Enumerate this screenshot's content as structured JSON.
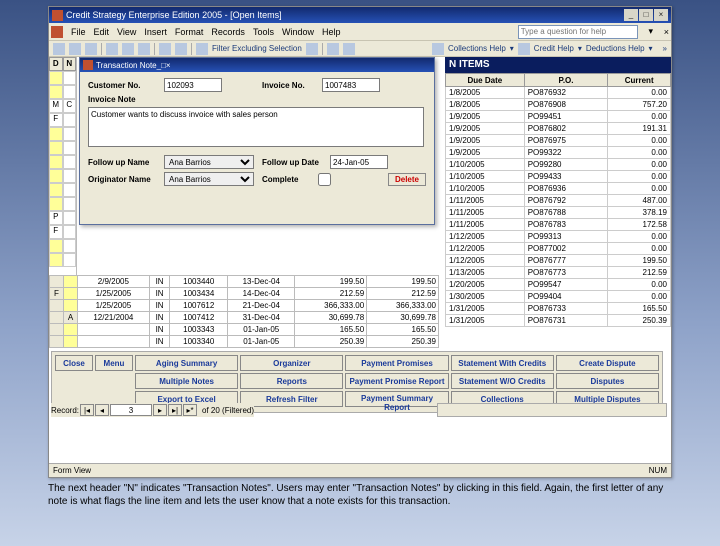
{
  "title_bar": {
    "title": "Credit Strategy Enterprise Edition 2005 - [Open Items]"
  },
  "menu": {
    "file": "File",
    "edit": "Edit",
    "view": "View",
    "insert": "Insert",
    "format": "Format",
    "records": "Records",
    "tools": "Tools",
    "window": "Window",
    "help": "Help",
    "help_placeholder": "Type a question for help"
  },
  "toolbar2": {
    "filter": "Filter Excluding Selection",
    "coll_help": "Collections Help",
    "cred_help": "Credit Help",
    "ded_help": "Deductions Help"
  },
  "left_hdr": {
    "d": "D",
    "n": "N",
    "m": "M",
    "f": "F",
    "p": "P",
    "a": "A",
    "c": "C"
  },
  "inner": {
    "title": "Transaction Note",
    "cust_no_lbl": "Customer No.",
    "cust_no": "102093",
    "inv_no_lbl": "Invoice No.",
    "inv_no": "1007483",
    "note_lbl": "Invoice Note",
    "note_text": "Customer wants to discuss invoice with sales person",
    "fup_name_lbl": "Follow up Name",
    "fup_name": "Ana Barrios",
    "fup_date_lbl": "Follow up Date",
    "fup_date": "24-Jan-05",
    "orig_name_lbl": "Originator Name",
    "orig_name": "Ana Barrios",
    "complete_lbl": "Complete",
    "delete": "Delete"
  },
  "right": {
    "banner": "N ITEMS",
    "hdr": {
      "due": "Due Date",
      "po": "P.O.",
      "curr": "Current"
    },
    "rows": [
      {
        "due": "1/8/2005",
        "po": "PO876932",
        "curr": "0.00"
      },
      {
        "due": "1/8/2005",
        "po": "PO876908",
        "curr": "757.20"
      },
      {
        "due": "1/9/2005",
        "po": "PO99451",
        "curr": "0.00"
      },
      {
        "due": "1/9/2005",
        "po": "PO876802",
        "curr": "191.31"
      },
      {
        "due": "1/9/2005",
        "po": "PO876975",
        "curr": "0.00"
      },
      {
        "due": "1/9/2005",
        "po": "PO99322",
        "curr": "0.00"
      },
      {
        "due": "1/10/2005",
        "po": "PO99280",
        "curr": "0.00"
      },
      {
        "due": "1/10/2005",
        "po": "PO99433",
        "curr": "0.00"
      },
      {
        "due": "1/10/2005",
        "po": "PO876936",
        "curr": "0.00"
      },
      {
        "due": "1/11/2005",
        "po": "PO876792",
        "curr": "487.00"
      },
      {
        "due": "1/11/2005",
        "po": "PO876788",
        "curr": "378.19"
      },
      {
        "due": "1/11/2005",
        "po": "PO876783",
        "curr": "172.58"
      },
      {
        "due": "1/12/2005",
        "po": "PO99313",
        "curr": "0.00"
      },
      {
        "due": "1/12/2005",
        "po": "PO877002",
        "curr": "0.00"
      },
      {
        "due": "1/12/2005",
        "po": "PO876777",
        "curr": "199.50"
      },
      {
        "due": "1/13/2005",
        "po": "PO876773",
        "curr": "212.59"
      },
      {
        "due": "1/20/2005",
        "po": "PO99547",
        "curr": "0.00"
      },
      {
        "due": "1/30/2005",
        "po": "PO99404",
        "curr": "0.00"
      },
      {
        "due": "1/31/2005",
        "po": "PO876733",
        "curr": "165.50"
      },
      {
        "due": "1/31/2005",
        "po": "PO876731",
        "curr": "250.39"
      }
    ]
  },
  "lower": {
    "rows": [
      {
        "m": "",
        "y": "",
        "d": "2/9/2005",
        "t": "IN",
        "inv": "1003440",
        "dt": "13-Dec-04",
        "a": "199.50",
        "b": "199.50"
      },
      {
        "m": "F",
        "y": "",
        "d": "1/25/2005",
        "t": "IN",
        "inv": "1003434",
        "dt": "14-Dec-04",
        "a": "212.59",
        "b": "212.59"
      },
      {
        "m": "",
        "y": "",
        "d": "1/25/2005",
        "t": "IN",
        "inv": "1007612",
        "dt": "21-Dec-04",
        "a": "366,333.00",
        "b": "366,333.00"
      },
      {
        "m": "",
        "y": "A",
        "d": "12/21/2004",
        "t": "IN",
        "inv": "1007412",
        "dt": "31-Dec-04",
        "a": "30,699.78",
        "b": "30,699.78"
      },
      {
        "m": "",
        "y": "",
        "d": "",
        "t": "IN",
        "inv": "1003343",
        "dt": "01-Jan-05",
        "a": "165.50",
        "b": "165.50"
      },
      {
        "m": "",
        "y": "",
        "d": "",
        "t": "IN",
        "inv": "1003340",
        "dt": "01-Jan-05",
        "a": "250.39",
        "b": "250.39"
      }
    ]
  },
  "btns": {
    "close": "Close",
    "menu": "Menu",
    "r1": [
      "Aging Summary",
      "Organizer",
      "Payment Promises",
      "Statement With Credits",
      "Create Dispute"
    ],
    "r2": [
      "Multiple Notes",
      "Reports",
      "Payment Promise Report",
      "Statement W/O Credits",
      "Disputes"
    ],
    "r3": [
      "Export to Excel",
      "Refresh Filter",
      "Payment Summary Report",
      "Collections",
      "Multiple Disputes"
    ]
  },
  "record": {
    "lbl": "Record:",
    "cur": "3",
    "of": "of  20 (Filtered)"
  },
  "status": {
    "view": "Form View",
    "num": "NUM"
  },
  "caption": "The next header \"N\" indicates \"Transaction Notes\". Users may enter \"Transaction Notes\" by clicking in this field. Again, the first letter of any note is what flags the line item and lets the user know that a note exists for this transaction."
}
